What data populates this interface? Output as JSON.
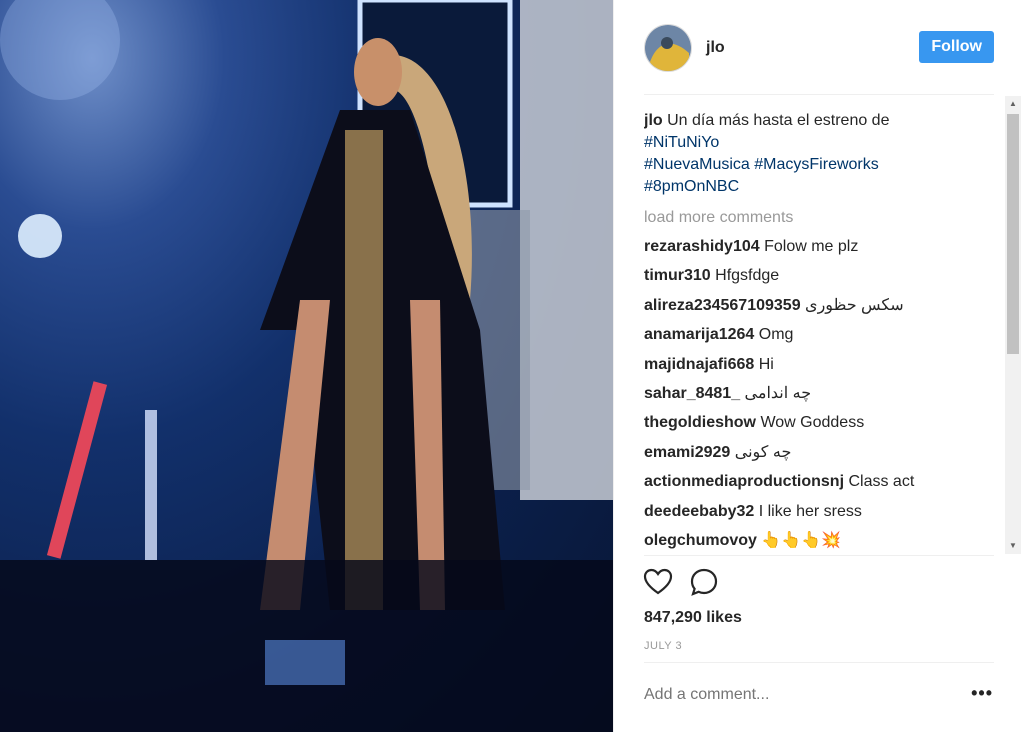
{
  "post": {
    "username": "jlo",
    "follow_label": "Follow",
    "caption": {
      "username": "jlo",
      "text": "Un día más hasta el estreno de",
      "hashtags": [
        "#NiTuNiYo",
        "#NuevaMusica",
        "#MacysFireworks",
        "#8pmOnNBC"
      ]
    },
    "load_more": "load more comments",
    "comments": [
      {
        "user": "rezarashidy104",
        "text": "Folow me plz"
      },
      {
        "user": "timur310",
        "text": "Hfgsfdge"
      },
      {
        "user": "alireza234567109359",
        "text": "سکس حظوری"
      },
      {
        "user": "anamarija1264",
        "text": "Omg"
      },
      {
        "user": "majidnajafi668",
        "text": "Hi"
      },
      {
        "user": "sahar_8481_",
        "text": "چه اندامی"
      },
      {
        "user": "thegoldieshow",
        "text": "Wow Goddess"
      },
      {
        "user": "emami2929",
        "text": "چه کونی"
      },
      {
        "user": "actionmediaproductionsnj",
        "text": "Class act"
      },
      {
        "user": "deedeebaby32",
        "text": "I like her sress"
      },
      {
        "user": "olegchumovoy",
        "text": "👆👆👆💥"
      }
    ],
    "likes": "847,290 likes",
    "date": "JULY 3",
    "add_comment_placeholder": "Add a comment...",
    "more_label": "•••"
  },
  "icons": {
    "like": "heart-icon",
    "comment": "comment-bubble-icon",
    "more": "more-options-icon"
  },
  "colors": {
    "follow_button": "#3897f0",
    "hashtag": "#003569",
    "muted": "#999999"
  }
}
